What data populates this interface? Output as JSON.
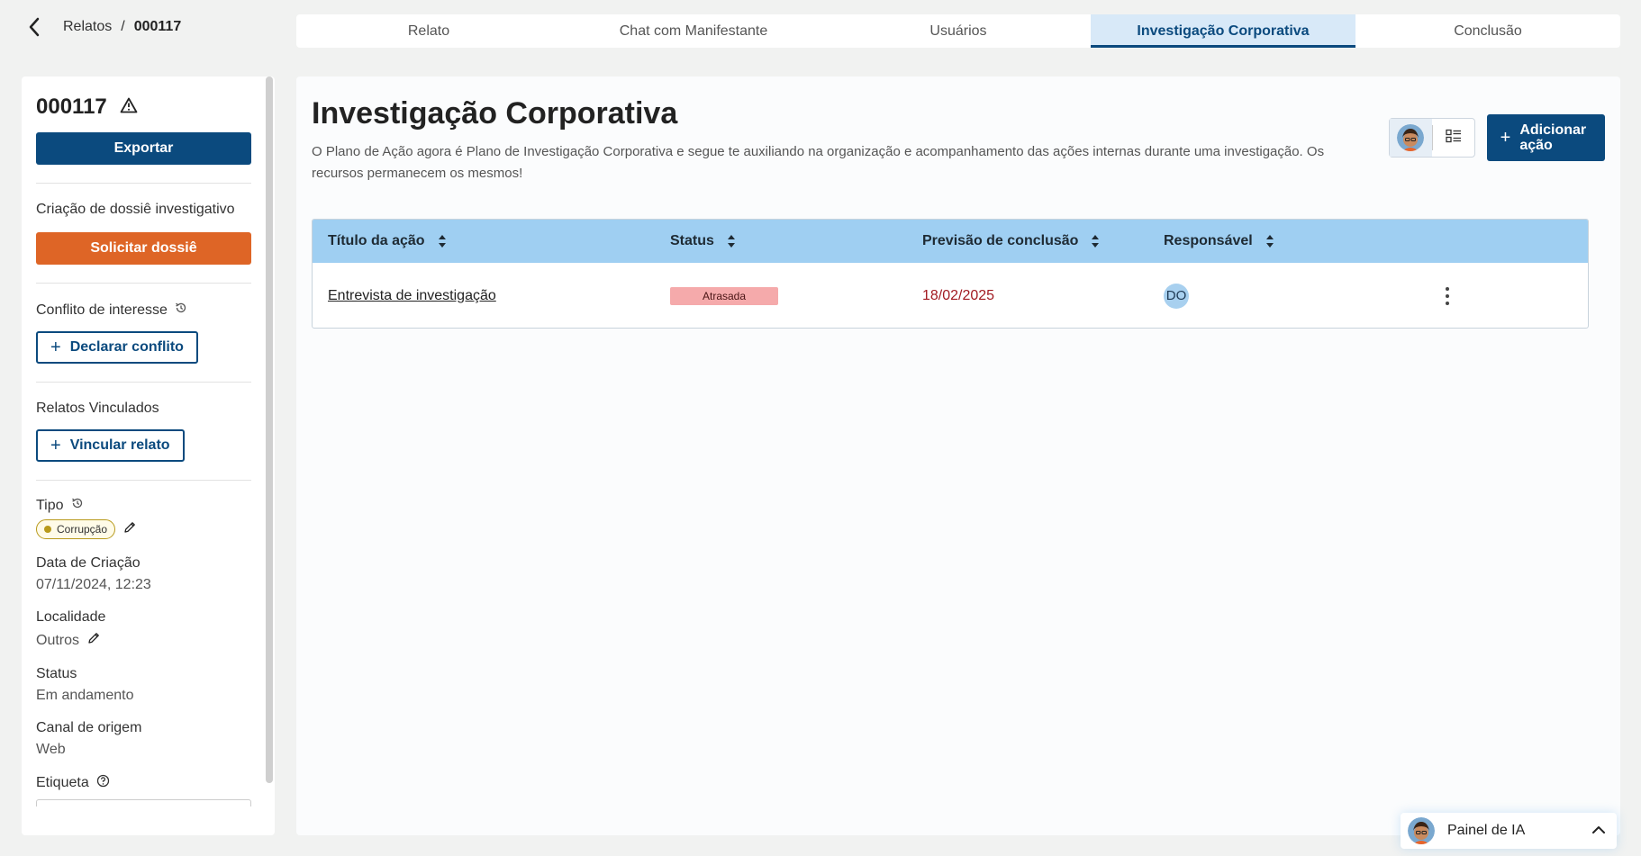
{
  "breadcrumb": {
    "parent": "Relatos",
    "separator": "/",
    "current": "000117"
  },
  "tabs": [
    {
      "label": "Relato",
      "active": false
    },
    {
      "label": "Chat com Manifestante",
      "active": false
    },
    {
      "label": "Usuários",
      "active": false
    },
    {
      "label": "Investigação Corporativa",
      "active": true
    },
    {
      "label": "Conclusão",
      "active": false
    }
  ],
  "sidebar": {
    "case_id": "000117",
    "export_label": "Exportar",
    "dossie_section": "Criação de dossiê investigativo",
    "dossie_button": "Solicitar dossiê",
    "conflict_section": "Conflito de interesse",
    "conflict_button": "Declarar conflito",
    "linked_section": "Relatos Vinculados",
    "linked_button": "Vincular relato",
    "tipo_label": "Tipo",
    "tipo_value": "Corrupção",
    "created_label": "Data de Criação",
    "created_value": "07/11/2024, 12:23",
    "locality_label": "Localidade",
    "locality_value": "Outros",
    "status_label": "Status",
    "status_value": "Em andamento",
    "channel_label": "Canal de origem",
    "channel_value": "Web",
    "tag_label": "Etiqueta"
  },
  "main": {
    "title": "Investigação Corporativa",
    "description": "O Plano de Ação agora é Plano de Investigação Corporativa e segue te auxiliando na organização e acompanhamento das ações internas durante uma investigação. Os recursos permanecem os mesmos!",
    "add_button": "Adicionar ação",
    "add_icon": "plus-icon"
  },
  "table": {
    "columns": [
      "Título da ação",
      "Status",
      "Previsão de conclusão",
      "Responsável"
    ],
    "rows": [
      {
        "title": "Entrevista de investigação",
        "status": "Atrasada",
        "due": "18/02/2025",
        "owner": "DO"
      }
    ]
  },
  "ai_panel": {
    "label": "Painel de IA"
  },
  "colors": {
    "primary": "#0b4a7e",
    "accent_orange": "#de6526",
    "table_header": "#9fcff2",
    "late_status": "#f5aaab",
    "late_date": "#a21b22"
  }
}
